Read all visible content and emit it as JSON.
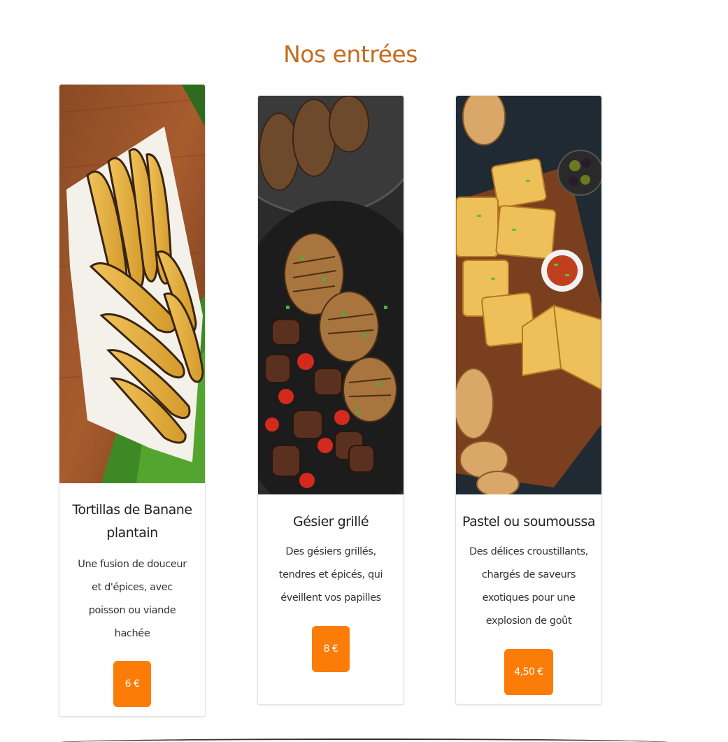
{
  "section": {
    "title": "Nos entrées"
  },
  "items": [
    {
      "name": "Tortillas de Banane plantain",
      "description": "Une fusion de douceur et d'épices, avec poisson ou viande hachée",
      "price": "6 €",
      "image": "grilled-plantain-photo"
    },
    {
      "name": "Gésier grillé",
      "description": "Des gésiers grillés, tendres et épicés, qui éveillent vos papilles",
      "price": "8 €",
      "image": "grilled-gizzard-skewers-photo"
    },
    {
      "name": "Pastel ou soumoussa",
      "description": "Des délices croustillants, chargés de saveurs exotiques pour une explosion de goût",
      "price": "4,50 €",
      "image": "pastel-tortilla-photo"
    }
  ],
  "colors": {
    "accent": "#c66a1c",
    "button": "#fb7d07"
  }
}
